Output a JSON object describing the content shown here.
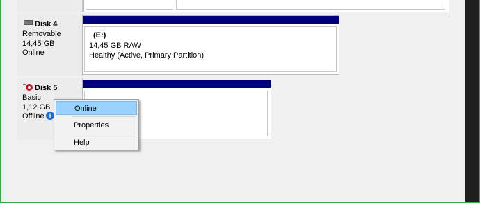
{
  "disks": [
    {
      "name": "Disk 4",
      "type": "Removable",
      "size": "14,45 GB",
      "status": "Online",
      "icon": "removable-drive-icon"
    },
    {
      "name": "Disk 5",
      "type": "Basic",
      "size": "1,12 GB",
      "status": "Offline",
      "icon": "offline-disk-icon"
    }
  ],
  "partitions": {
    "disk4": {
      "letter": "(E:)",
      "size": "14,45 GB RAW",
      "status": "Healthy (Active, Primary Partition)"
    }
  },
  "context_menu": {
    "items": [
      "Online",
      "Properties",
      "Help"
    ],
    "highlighted": "Online"
  },
  "colors": {
    "partition_bar": "#00007a",
    "menu_highlight": "#99d1ff",
    "offline_icon": "#c2162a",
    "info_icon": "#1a6fcc"
  }
}
